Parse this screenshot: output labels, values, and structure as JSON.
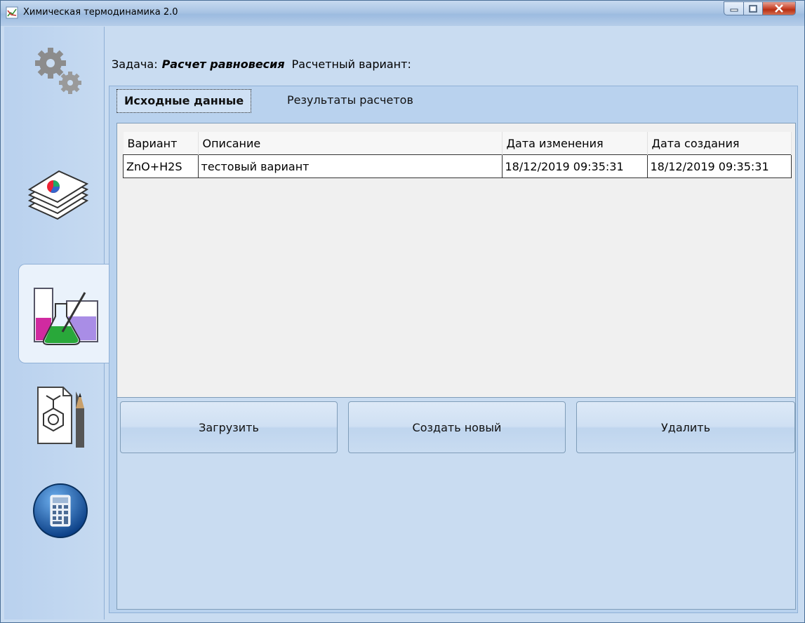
{
  "window": {
    "title": "Химическая термодинамика 2.0"
  },
  "sidebar": {
    "items": [
      {
        "name": "settings",
        "icon": "gears-icon"
      },
      {
        "name": "database",
        "icon": "document-stack-icon"
      },
      {
        "name": "chemistry",
        "icon": "lab-flasks-icon",
        "active": true
      },
      {
        "name": "structure-editor",
        "icon": "molecule-pencil-icon"
      },
      {
        "name": "calculator",
        "icon": "calculator-icon"
      }
    ]
  },
  "task": {
    "label": "Задача:",
    "name": "Расчет равновесия",
    "variant_label": "Расчетный вариант:"
  },
  "tabs": [
    {
      "label": "Исходные данные",
      "active": true
    },
    {
      "label": "Результаты расчетов",
      "active": false
    }
  ],
  "table": {
    "columns": [
      "Вариант",
      "Описание",
      "Дата изменения",
      "Дата создания"
    ],
    "rows": [
      [
        "ZnO+H2S",
        "тестовый вариант",
        "18/12/2019 09:35:31",
        "18/12/2019 09:35:31"
      ]
    ]
  },
  "buttons": {
    "load": "Загрузить",
    "create": "Создать новый",
    "delete": "Удалить"
  }
}
